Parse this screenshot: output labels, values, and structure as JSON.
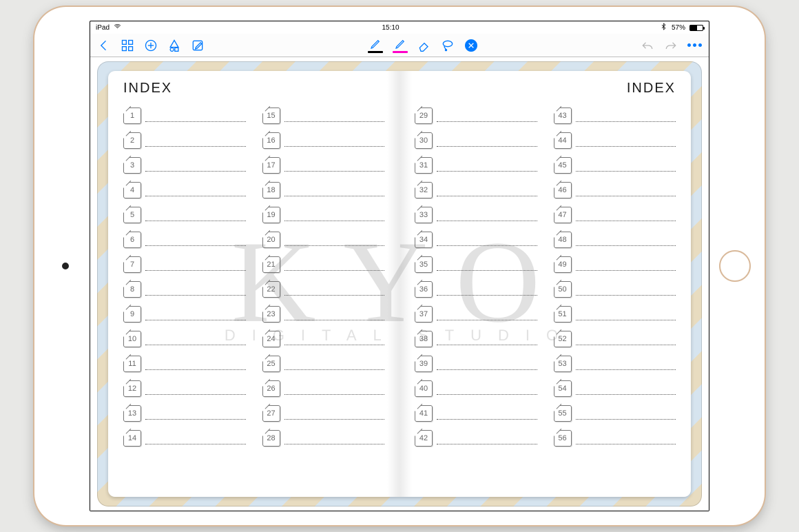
{
  "status": {
    "carrier": "iPad",
    "time": "15:10",
    "battery_pct": "57%"
  },
  "toolbar": {
    "pen_color": "#000000",
    "highlighter_color": "#ff00c8"
  },
  "notebook": {
    "left_title": "INDEX",
    "right_title": "INDEX",
    "columns": [
      [
        "1",
        "2",
        "3",
        "4",
        "5",
        "6",
        "7",
        "8",
        "9",
        "10",
        "11",
        "12",
        "13",
        "14"
      ],
      [
        "15",
        "16",
        "17",
        "18",
        "19",
        "20",
        "21",
        "22",
        "23",
        "24",
        "25",
        "26",
        "27",
        "28"
      ],
      [
        "29",
        "30",
        "31",
        "32",
        "33",
        "34",
        "35",
        "36",
        "37",
        "38",
        "39",
        "40",
        "41",
        "42"
      ],
      [
        "43",
        "44",
        "45",
        "46",
        "47",
        "48",
        "49",
        "50",
        "51",
        "52",
        "53",
        "54",
        "55",
        "56"
      ]
    ]
  },
  "watermark": {
    "big": "KYO",
    "small": "DIGITAL STUDIO"
  }
}
